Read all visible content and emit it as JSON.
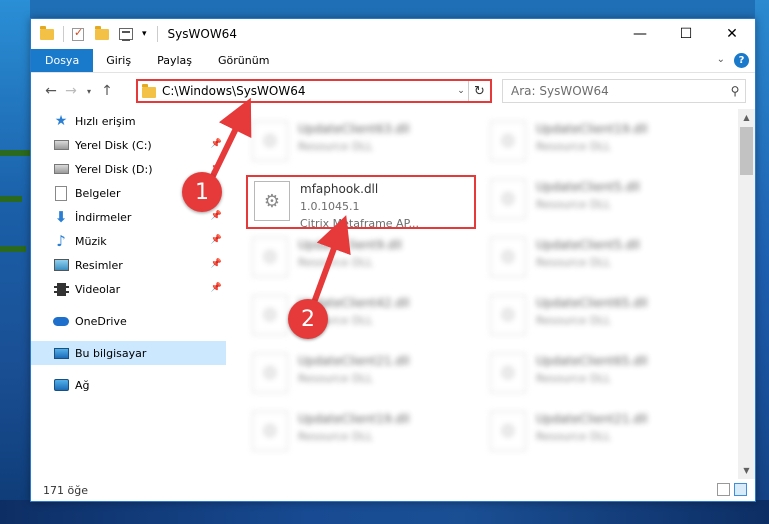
{
  "window": {
    "title": "SysWOW64",
    "controls": {
      "minimize": "—",
      "maximize": "☐",
      "close": "✕"
    }
  },
  "ribbon": {
    "tabs": [
      {
        "label": "Dosya",
        "active": true
      },
      {
        "label": "Giriş"
      },
      {
        "label": "Paylaş"
      },
      {
        "label": "Görünüm"
      }
    ],
    "help": "?"
  },
  "address": {
    "path": "C:\\Windows\\SysWOW64"
  },
  "search": {
    "placeholder": "Ara: SysWOW64"
  },
  "sidebar": {
    "items": [
      {
        "label": "Hızlı erişim",
        "icon": "star-icon"
      },
      {
        "label": "Yerel Disk (C:)",
        "icon": "disk-icon",
        "pinned": true
      },
      {
        "label": "Yerel Disk (D:)",
        "icon": "disk-icon",
        "pinned": true
      },
      {
        "label": "Belgeler",
        "icon": "document-icon",
        "pinned": true
      },
      {
        "label": "İndirmeler",
        "icon": "download-icon",
        "pinned": true
      },
      {
        "label": "Müzik",
        "icon": "music-icon",
        "pinned": true
      },
      {
        "label": "Resimler",
        "icon": "pictures-icon",
        "pinned": true
      },
      {
        "label": "Videolar",
        "icon": "videos-icon",
        "pinned": true
      },
      {
        "label": "OneDrive",
        "icon": "cloud-icon"
      },
      {
        "label": "Bu bilgisayar",
        "icon": "computer-icon",
        "selected": true
      },
      {
        "label": "Ağ",
        "icon": "network-icon"
      }
    ]
  },
  "files": [
    {
      "name": "UpdateClient63.dll",
      "sub1": "Resource DLL"
    },
    {
      "name": "UpdateClient19.dll",
      "sub1": "Resource DLL"
    },
    {
      "name": "mfaphook.dll",
      "sub1": "1.0.1045.1",
      "sub2": "Citrix Metaframe AP..."
    },
    {
      "name": "UpdateClient5.dll",
      "sub1": "Resource DLL"
    },
    {
      "name": "UpdateClient9.dll",
      "sub1": "Resource DLL"
    },
    {
      "name": "UpdateClient5.dll",
      "sub1": "Resource DLL"
    },
    {
      "name": "UpdateClient42.dll",
      "sub1": "Resource DLL"
    },
    {
      "name": "UpdateClient65.dll",
      "sub1": "Resource DLL"
    },
    {
      "name": "UpdateClient21.dll",
      "sub1": "Resource DLL"
    },
    {
      "name": "UpdateClient65.dll",
      "sub1": "Resource DLL"
    },
    {
      "name": "UpdateClient19.dll",
      "sub1": "Resource DLL"
    },
    {
      "name": "UpdateClient21.dll",
      "sub1": "Resource DLL"
    }
  ],
  "status": {
    "count": "171 öğe"
  },
  "annotations": {
    "step1": "1",
    "step2": "2",
    "color": "#e5393a"
  }
}
